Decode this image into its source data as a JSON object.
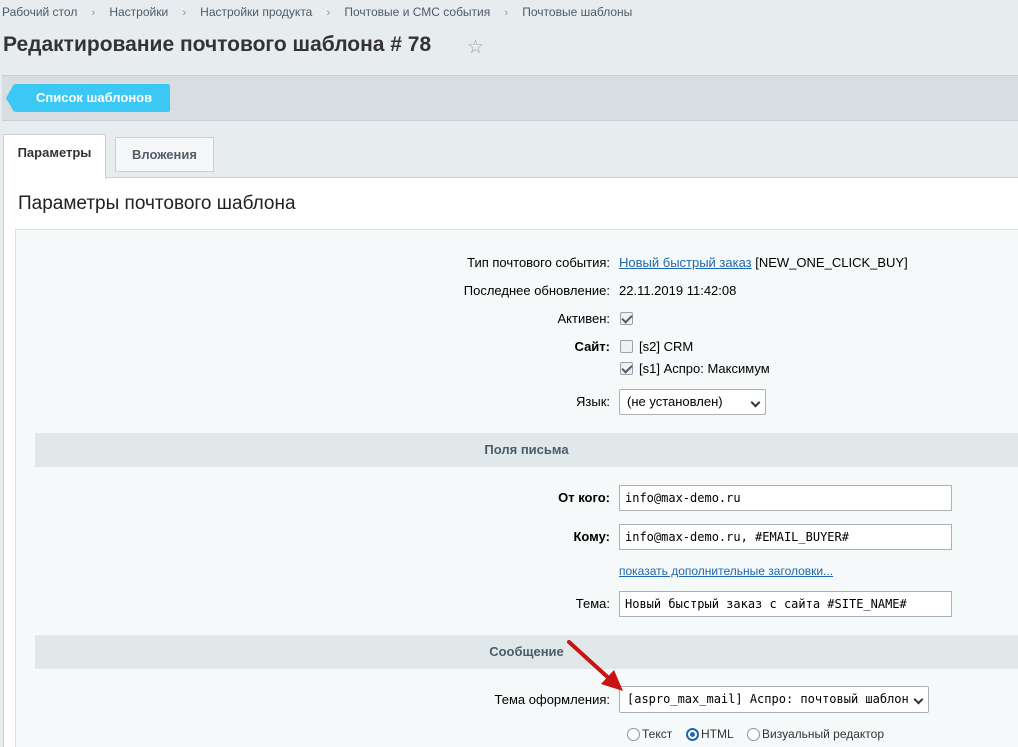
{
  "breadcrumb": [
    "Рабочий стол",
    "Настройки",
    "Настройки продукта",
    "Почтовые и СМС события",
    "Почтовые шаблоны"
  ],
  "page_title": "Редактирование почтового шаблона # 78",
  "toolbar": {
    "back_label": "Список шаблонов"
  },
  "tabs": [
    {
      "label": "Параметры",
      "active": true
    },
    {
      "label": "Вложения",
      "active": false
    }
  ],
  "panel_title": "Параметры почтового шаблона",
  "form": {
    "event_type_label": "Тип почтового события:",
    "event_type_link": "Новый быстрый заказ",
    "event_type_code": "[NEW_ONE_CLICK_BUY]",
    "last_update_label": "Последнее обновление:",
    "last_update_value": "22.11.2019 11:42:08",
    "active_label": "Активен:",
    "active": true,
    "site_label": "Сайт:",
    "sites": [
      {
        "label": "[s2] CRM",
        "checked": false
      },
      {
        "label": "[s1] Аспро: Максимум",
        "checked": true
      }
    ],
    "language_label": "Язык:",
    "language_value": "(не установлен)"
  },
  "letter_fields": {
    "heading": "Поля письма",
    "from_label": "От кого:",
    "from_value": "info@max-demo.ru",
    "to_label": "Кому:",
    "to_value": "info@max-demo.ru, #EMAIL_BUYER#",
    "more_headers_link": "показать дополнительные заголовки...",
    "subject_label": "Тема:",
    "subject_value": "Новый быстрый заказ с сайта #SITE_NAME#"
  },
  "message": {
    "heading": "Сообщение",
    "theme_label": "Тема оформления:",
    "theme_value": "[aspro_max_mail] Аспро: почтовый шаблон",
    "format_options": [
      "Текст",
      "HTML",
      "Визуальный редактор"
    ],
    "format_selected": "HTML"
  },
  "colors": {
    "accent": "#3bc8f5",
    "link": "#2067b0",
    "annotation_arrow": "#c81414"
  }
}
